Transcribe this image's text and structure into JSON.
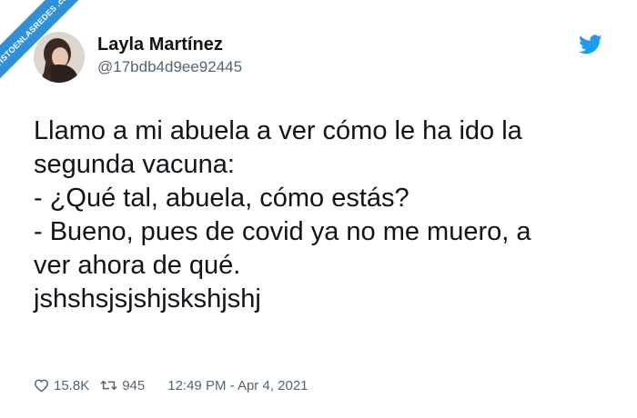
{
  "watermark": {
    "text": "VISTOENLASREDES .com"
  },
  "author": {
    "name": "Layla Martínez",
    "handle": "@17bdb4d9ee92445"
  },
  "icons": {
    "brand": "twitter-bird-icon",
    "like": "heart-icon",
    "retweet": "retweet-icon"
  },
  "colors": {
    "brand": "#1d9bf0",
    "text": "#0f1419",
    "muted": "#536471",
    "ribbon": "#2f8fd8"
  },
  "tweet": {
    "lines": [
      "Llamo a mi abuela a ver cómo le ha ido la",
      "segunda vacuna:",
      "- ¿Qué tal, abuela, cómo estás?",
      "- Bueno, pues de covid ya no me muero, a",
      "ver ahora de qué.",
      "jshshsjsjshjskshjshj"
    ]
  },
  "stats": {
    "likes": "15.8K",
    "retweets": "945",
    "timestamp": "12:49 PM - Apr 4, 2021"
  }
}
